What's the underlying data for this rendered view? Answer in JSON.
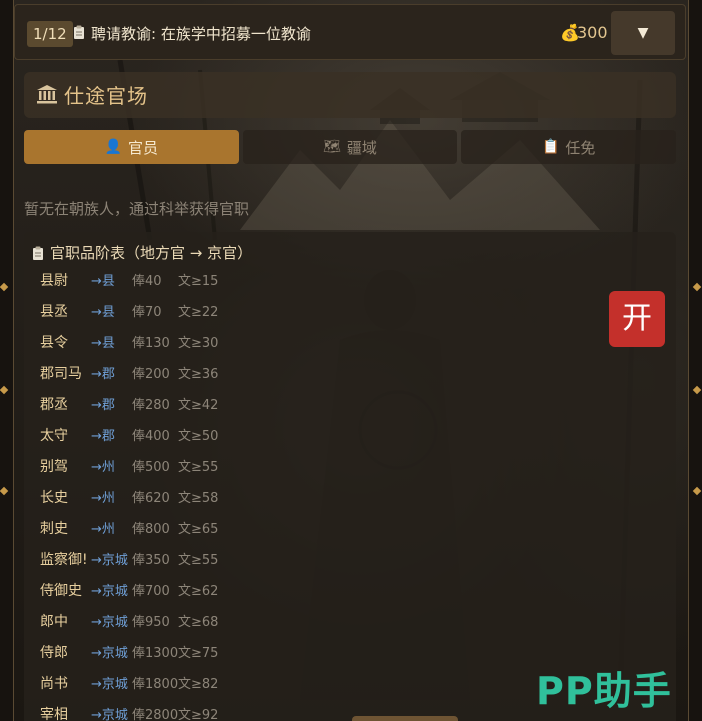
{
  "task_bar": {
    "counter": "1/12",
    "icon": "clipboard-icon",
    "text": "聘请教谕: 在族学中招募一位教谕",
    "coin_icon": "money-bag-icon",
    "coins": "300",
    "dropdown_glyph": "▼"
  },
  "panel": {
    "icon": "classical-building-icon",
    "title": "仕途官场"
  },
  "tabs": [
    {
      "label": "官员",
      "icon": "person-icon",
      "active": true
    },
    {
      "label": "疆域",
      "icon": "map-icon",
      "active": false
    },
    {
      "label": "任免",
      "icon": "clipboard-icon",
      "active": false
    }
  ],
  "empty_message": "暂无在朝族人，通过科举获得官职",
  "rank_table": {
    "title": "官职品阶表（地方官 → 京官）",
    "rows": [
      {
        "name": "县尉",
        "level": "→县",
        "salary": "俸40",
        "req": "文≥15"
      },
      {
        "name": "县丞",
        "level": "→县",
        "salary": "俸70",
        "req": "文≥22"
      },
      {
        "name": "县令",
        "level": "→县",
        "salary": "俸130",
        "req": "文≥30"
      },
      {
        "name": "郡司马",
        "level": "→郡",
        "salary": "俸200",
        "req": "文≥36"
      },
      {
        "name": "郡丞",
        "level": "→郡",
        "salary": "俸280",
        "req": "文≥42"
      },
      {
        "name": "太守",
        "level": "→郡",
        "salary": "俸400",
        "req": "文≥50"
      },
      {
        "name": "别驾",
        "level": "→州",
        "salary": "俸500",
        "req": "文≥55"
      },
      {
        "name": "长史",
        "level": "→州",
        "salary": "俸620",
        "req": "文≥58"
      },
      {
        "name": "刺史",
        "level": "→州",
        "salary": "俸800",
        "req": "文≥65"
      },
      {
        "name": "监察御!",
        "level": "→京城",
        "salary": "俸350",
        "req": "文≥55"
      },
      {
        "name": "侍御史",
        "level": "→京城",
        "salary": "俸700",
        "req": "文≥62"
      },
      {
        "name": "郎中",
        "level": "→京城",
        "salary": "俸950",
        "req": "文≥68"
      },
      {
        "name": "侍郎",
        "level": "→京城",
        "salary": "俸1300",
        "req": "文≥75"
      },
      {
        "name": "尚书",
        "level": "→京城",
        "salary": "俸1800",
        "req": "文≥82"
      },
      {
        "name": "宰相",
        "level": "→京城",
        "salary": "俸2800",
        "req": "文≥92"
      }
    ]
  },
  "open_button": "开",
  "watermark": "PP助手",
  "colors": {
    "active_tab": "#a9752e",
    "gold_text": "#e4c38a",
    "level_blue": "#6f9fd6",
    "open_button": "#c4302b",
    "watermark": "#30c09b"
  }
}
